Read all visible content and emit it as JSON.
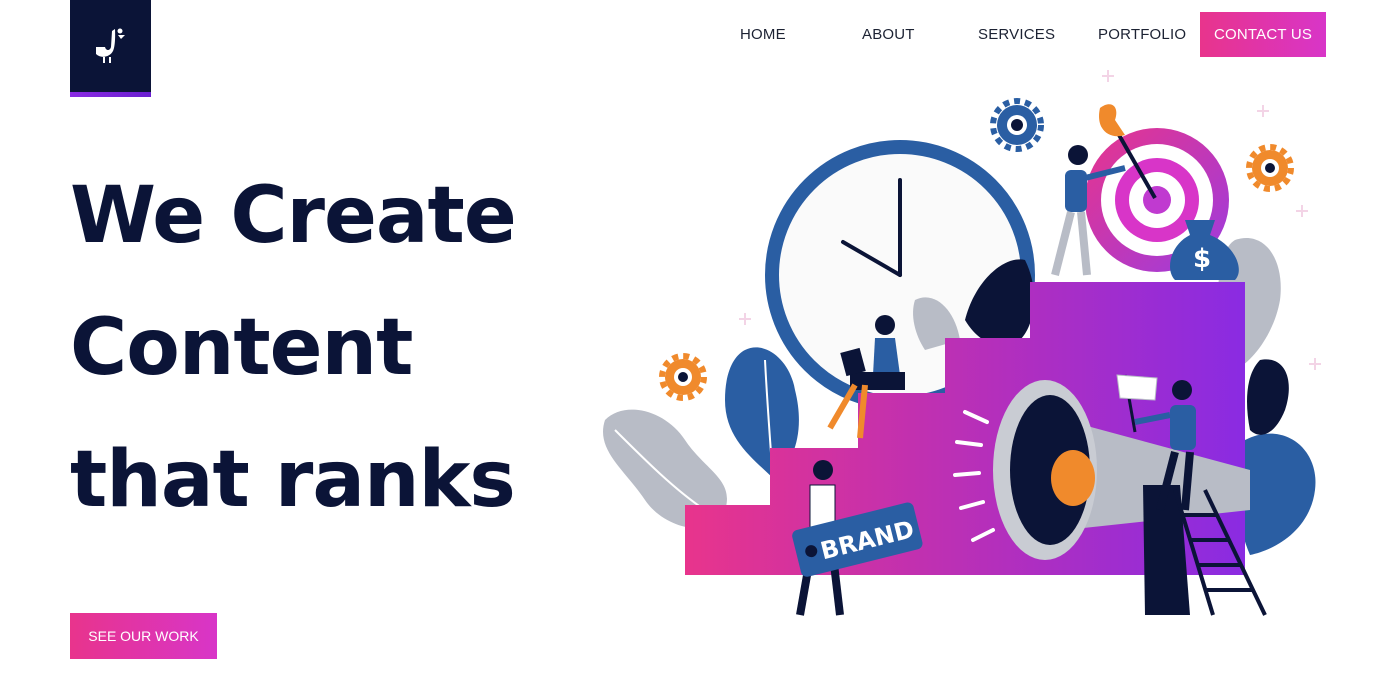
{
  "nav": {
    "home": "HOME",
    "about": "ABOUT",
    "services": "SERVICES",
    "portfolio": "PORTFOLIO",
    "contact": "CONTACT US"
  },
  "hero": {
    "line1": "We Create",
    "line2": "Content",
    "line3": "that ranks",
    "cta": "SEE OUR WORK"
  },
  "illustration": {
    "brand_tag": "BRAND",
    "money_symbol": "$"
  },
  "colors": {
    "navy": "#0b1437",
    "pink": "#e8348c",
    "magenta": "#d835c8",
    "purple": "#8a2be2",
    "blue": "#2a5ea3",
    "orange": "#f08a2c"
  }
}
